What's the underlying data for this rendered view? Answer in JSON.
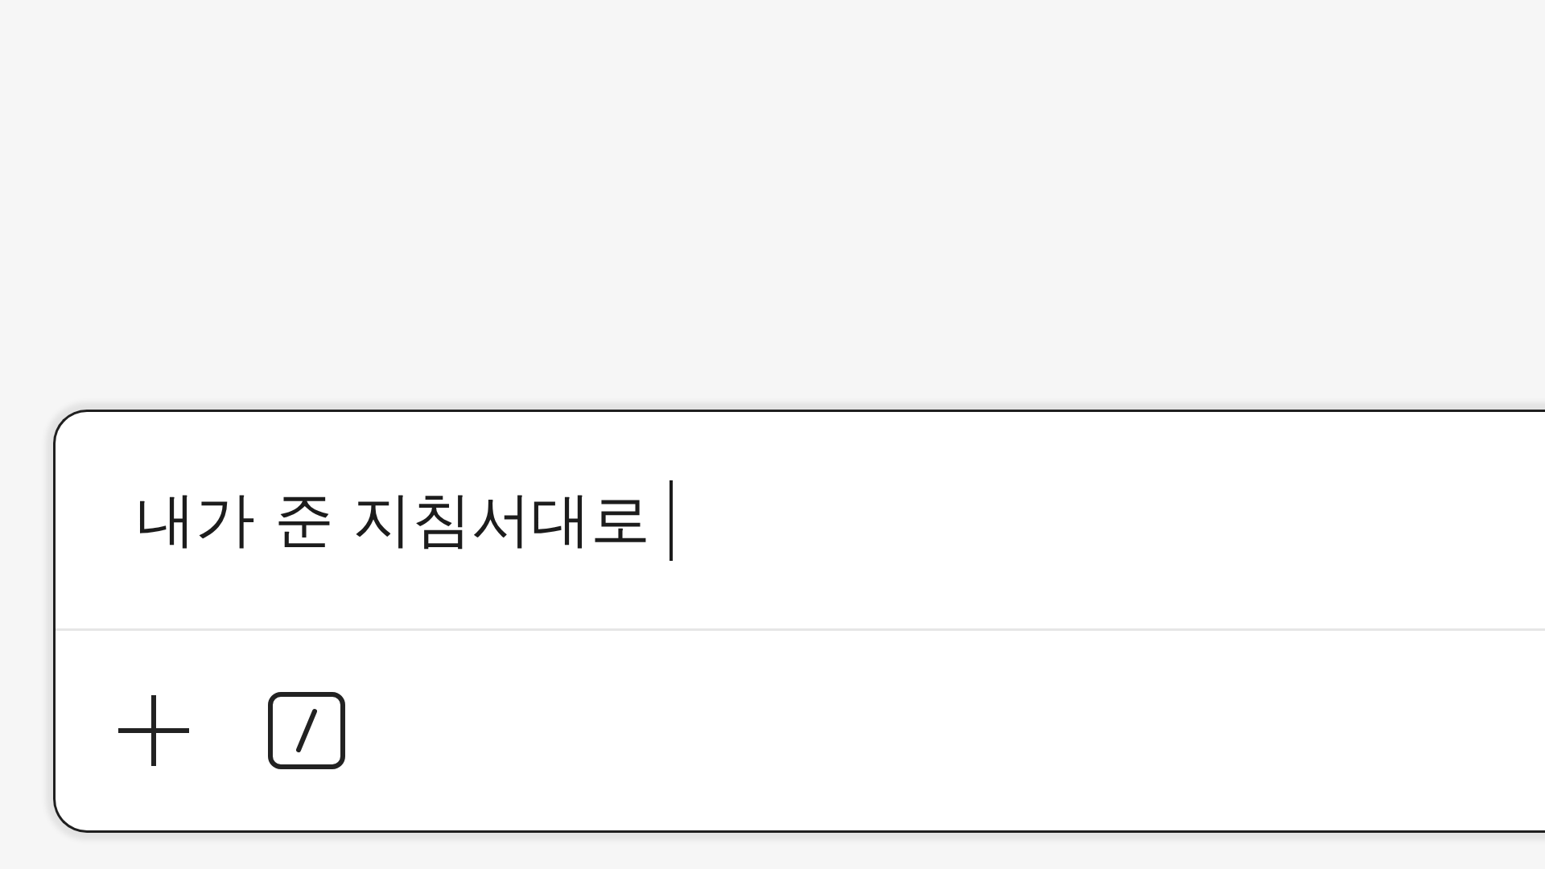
{
  "composer": {
    "value": "내가 준 지침서대로",
    "focused": true
  }
}
